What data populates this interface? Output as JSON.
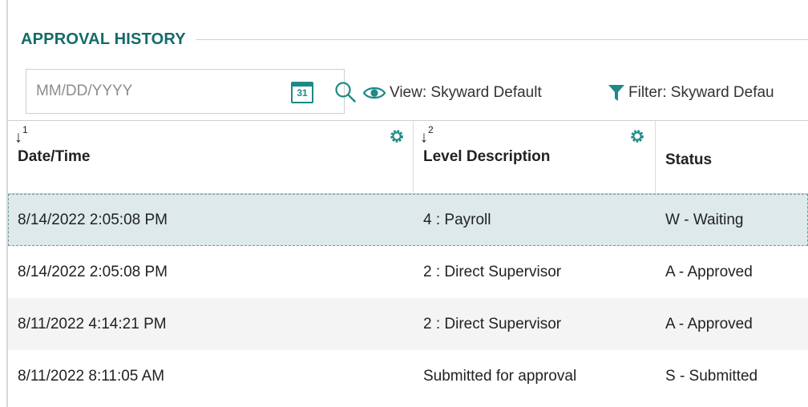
{
  "section": {
    "title": "APPROVAL HISTORY"
  },
  "toolbar": {
    "date_placeholder": "MM/DD/YYYY",
    "calendar_day": "31",
    "view_label": "View: Skyward Default",
    "filter_label": "Filter: Skyward Defau"
  },
  "table": {
    "columns": [
      {
        "sort_order": "1",
        "label": "Date/Time"
      },
      {
        "sort_order": "2",
        "label": "Level Description"
      },
      {
        "label": "Status"
      }
    ],
    "rows": [
      {
        "date_time": "8/14/2022 2:05:08 PM",
        "level": "4 : Payroll",
        "status": "W - Waiting"
      },
      {
        "date_time": "8/14/2022 2:05:08 PM",
        "level": "2 : Direct Supervisor",
        "status": "A - Approved"
      },
      {
        "date_time": "8/11/2022 4:14:21 PM",
        "level": "2 : Direct Supervisor",
        "status": "A - Approved"
      },
      {
        "date_time": "8/11/2022 8:11:05 AM",
        "level": "Submitted for approval",
        "status": "S - Submitted"
      }
    ]
  },
  "colors": {
    "accent": "#146b6a",
    "icon_teal": "#1c8a86",
    "selected_row": "#dde9ea",
    "alt_row": "#f4f4f4"
  },
  "icons": {
    "calendar": "calendar-icon",
    "search": "search-icon",
    "view": "eye-icon",
    "filter": "funnel-icon",
    "column_settings": "gear-icon",
    "sort": "sort-down-arrow-icon"
  }
}
